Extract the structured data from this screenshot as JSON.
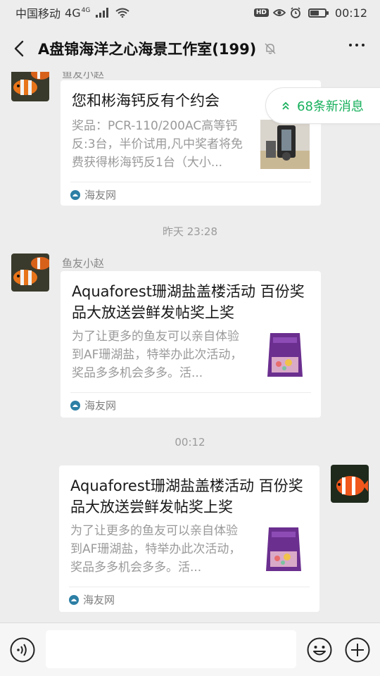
{
  "status_bar": {
    "carrier": "中国移动",
    "network": "4G",
    "network_sup": "4G",
    "hd_badge": "HD",
    "time": "00:12",
    "battery_level": 0.55
  },
  "header": {
    "title": "A盘锦海洋之心海景工作室(199)",
    "back_icon": "chevron-left-icon",
    "mute_icon": "bell-off-icon",
    "more_icon": "more-dots-icon"
  },
  "new_messages": {
    "label": "68条新消息",
    "icon": "double-chevron-up-icon",
    "color": "#18b05c"
  },
  "messages": [
    {
      "sender": "鱼友小赵",
      "side": "left",
      "card": {
        "title": "您和彬海钙反有个约会",
        "description": "奖品：PCR-110/200AC高等钙反:3台，半价试用,凡中奖者将免费获得彬海钙反1台（大小...",
        "source": "海友网",
        "thumbnail": "calcium-reactor-image"
      }
    },
    {
      "timestamp": "昨天 23:28"
    },
    {
      "sender": "鱼友小赵",
      "side": "left",
      "card": {
        "title": "Aquaforest珊湖盐盖楼活动 百份奖品大放送尝鲜发帖奖上奖",
        "description": "为了让更多的鱼友可以亲自体验到AF珊湖盐，特举办此次活动，奖品多多机会多多。活...",
        "source": "海友网",
        "thumbnail": "reef-salt-bag-image"
      }
    },
    {
      "timestamp": "00:12"
    },
    {
      "side": "right",
      "card": {
        "title": "Aquaforest珊湖盐盖楼活动 百份奖品大放送尝鲜发帖奖上奖",
        "description": "为了让更多的鱼友可以亲自体验到AF珊湖盐，特举办此次活动，奖品多多机会多多。活...",
        "source": "海友网",
        "thumbnail": "reef-salt-bag-image"
      }
    }
  ],
  "input_bar": {
    "voice_icon": "voice-icon",
    "text_value": "",
    "emoji_icon": "emoji-icon",
    "plus_icon": "plus-icon"
  }
}
